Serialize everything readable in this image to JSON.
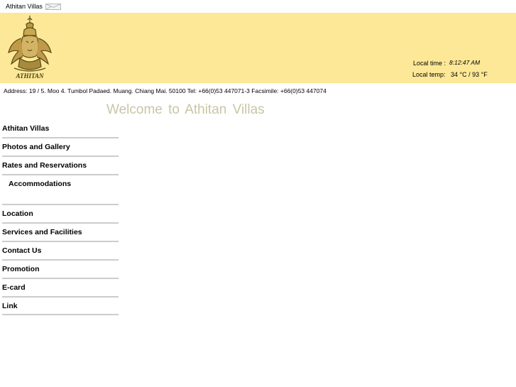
{
  "top": {
    "site_name": "Athitan Villas",
    "mail_icon": "envelope-icon"
  },
  "header": {
    "logo_text": "ATHITAN",
    "time_label": "Local time :",
    "time_value": "8:12:47 AM",
    "temp_label": "Local temp:",
    "temp_value": "34 °C / 93 °F",
    "bg_color": "#fce896"
  },
  "address": "Address: 19 / 5. Moo 4. Tumbol Padaed. Muang. Chiang Mai. 50100 Tel: +66(0)53 447071-3 Facsimile: +66(0)53 447074",
  "welcome": "Welcome to Athitan Villas",
  "nav": {
    "items": [
      {
        "label": "Athitan Villas"
      },
      {
        "label": "Photos and Gallery"
      },
      {
        "label": "Rates and Reservations"
      },
      {
        "label": "Accommodations"
      },
      {
        "label": "Location"
      },
      {
        "label": "Services and Facilities"
      },
      {
        "label": "Contact Us"
      },
      {
        "label": "Promotion"
      },
      {
        "label": "E-card"
      },
      {
        "label": "Link"
      }
    ]
  }
}
